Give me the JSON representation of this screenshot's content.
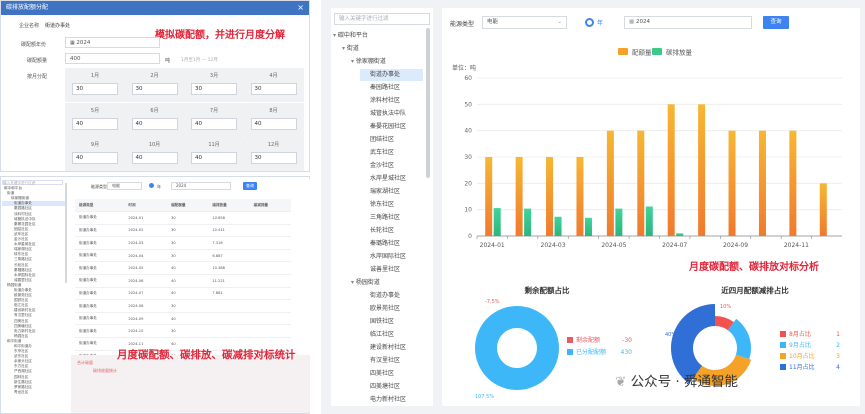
{
  "dialog": {
    "title": "碳排放配额分配",
    "close": "×",
    "enterprise_label": "企业名称",
    "enterprise_value": "街道办事处",
    "year_label": "碳配额年份",
    "year_value": "2024",
    "quota_label": "碳配额量",
    "quota_value": "400",
    "unit_label": "吨",
    "allocate_label": "按月分配",
    "range_hint": "1月至1月   —   12月",
    "months": [
      {
        "label": "1月",
        "value": "30"
      },
      {
        "label": "2月",
        "value": "30"
      },
      {
        "label": "3月",
        "value": "30"
      },
      {
        "label": "4月",
        "value": "30"
      },
      {
        "label": "5月",
        "value": "40"
      },
      {
        "label": "6月",
        "value": "40"
      },
      {
        "label": "7月",
        "value": "40"
      },
      {
        "label": "8月",
        "value": "40"
      },
      {
        "label": "9月",
        "value": "40"
      },
      {
        "label": "10月",
        "value": "40"
      },
      {
        "label": "11月",
        "value": "40"
      },
      {
        "label": "12月",
        "value": "30"
      }
    ]
  },
  "captions": {
    "c1": "模拟碳配额，并进行月度分解",
    "c2": "月度碳配额、碳排放、碳减排对标统计",
    "c3": "月度碳配额、碳排放对标分析"
  },
  "mini": {
    "search_placeholder": "输入关键字进行过滤",
    "tree": [
      "碳中和平台",
      "街道",
      "徐家棚街道",
      "街道办事处",
      "秦园路社区",
      "涂料村社区",
      "城管执法中队",
      "秦晏花园社区",
      "团结社区",
      "武车社区",
      "金沙社区",
      "水岸星城社区",
      "瑞家湖社区",
      "徐东社区",
      "三角路社区",
      "长轮社区",
      "秦璐路社区",
      "水岸国际社区",
      "诚善里社区",
      "杨园街道",
      "街道办事处",
      "欧景苑社区",
      "国铁社区",
      "临江社区",
      "建设新村社区",
      "有汉里社区",
      "四美社区",
      "四美塘社区",
      "电力新村社区",
      "杨园社区",
      "和平街道",
      "和平街道办",
      "东亭社区",
      "武东社区",
      "余家头社区",
      "东方社区",
      "严西湖社区",
      "园林社区",
      "新生路社区",
      "罗家路社区",
      "青龙社区"
    ],
    "filter_label": "能源类型",
    "filter_value": "电能",
    "radio_label": "年",
    "date_value": "2024",
    "query_label": "查询",
    "columns": [
      "能源类型",
      "时间",
      "碳配额量",
      "碳排放量",
      "碳减排量"
    ],
    "rows": [
      [
        "街道办事处",
        "2024-01",
        "30",
        "10.658",
        ""
      ],
      [
        "街道办事处",
        "2024-02",
        "30",
        "10.411",
        ""
      ],
      [
        "街道办事处",
        "2024-03",
        "30",
        "7.316",
        ""
      ],
      [
        "街道办事处",
        "2024-04",
        "30",
        "6.887",
        ""
      ],
      [
        "街道办事处",
        "2024-05",
        "40",
        "10.388",
        ""
      ],
      [
        "街道办事处",
        "2024-06",
        "40",
        "11.221",
        ""
      ],
      [
        "街道办事处",
        "2024-07",
        "40",
        "7.881",
        ""
      ],
      [
        "街道办事处",
        "2024-08",
        "30",
        "",
        " "
      ],
      [
        "街道办事处",
        "2024-09",
        "40",
        "",
        ""
      ],
      [
        "街道办事处",
        "2024-10",
        "30",
        "",
        ""
      ],
      [
        "街道办事处",
        "2024-11",
        "40",
        "",
        ""
      ],
      [
        "街道办事处",
        "2024-12",
        "30",
        "",
        ""
      ]
    ],
    "footer_a": "合计碳量",
    "footer_b": "碳排放量统计"
  },
  "right": {
    "search_placeholder": "输入关键字进行过滤",
    "tree": [
      {
        "t": "碳中和平台",
        "lvl": 0,
        "arrow": "▾"
      },
      {
        "t": "街道",
        "lvl": 1,
        "arrow": "▾"
      },
      {
        "t": "徐家棚街道",
        "lvl": 2,
        "arrow": "▾"
      },
      {
        "t": "街道办事处",
        "lvl": 3,
        "sel": true
      },
      {
        "t": "秦园路社区",
        "lvl": 3
      },
      {
        "t": "涂料村社区",
        "lvl": 3
      },
      {
        "t": "城管执法中队",
        "lvl": 3
      },
      {
        "t": "秦晏花园社区",
        "lvl": 3
      },
      {
        "t": "团结社区",
        "lvl": 3
      },
      {
        "t": "武车社区",
        "lvl": 3
      },
      {
        "t": "金沙社区",
        "lvl": 3
      },
      {
        "t": "水岸星城社区",
        "lvl": 3
      },
      {
        "t": "瑞家湖社区",
        "lvl": 3
      },
      {
        "t": "徐东社区",
        "lvl": 3
      },
      {
        "t": "三角路社区",
        "lvl": 3
      },
      {
        "t": "长轮社区",
        "lvl": 3
      },
      {
        "t": "秦璐路社区",
        "lvl": 3
      },
      {
        "t": "水岸国际社区",
        "lvl": 3
      },
      {
        "t": "诚善里社区",
        "lvl": 3
      },
      {
        "t": "杨园街道",
        "lvl": 2,
        "arrow": "▾"
      },
      {
        "t": "街道办事处",
        "lvl": 3
      },
      {
        "t": "欧景苑社区",
        "lvl": 3
      },
      {
        "t": "国铁社区",
        "lvl": 3
      },
      {
        "t": "临江社区",
        "lvl": 3
      },
      {
        "t": "建设新村社区",
        "lvl": 3
      },
      {
        "t": "有汉里社区",
        "lvl": 3
      },
      {
        "t": "四美社区",
        "lvl": 3
      },
      {
        "t": "四美塘社区",
        "lvl": 3
      },
      {
        "t": "电力新村社区",
        "lvl": 3
      }
    ],
    "energy_label": "能源类型",
    "energy_value": "电能",
    "radio_label": "年",
    "date_value": "2024",
    "query_label": "查询",
    "watermark": "公众号 · 舜通智能"
  },
  "colors": {
    "quota": "#f6a228",
    "emission": "#3cc98a",
    "remain": "#e85a64",
    "allocated": "#3db7f7"
  },
  "chart_data": [
    {
      "type": "bar",
      "ylabel": "单位：吨",
      "ylim": [
        0,
        60
      ],
      "yticks": [
        0,
        10,
        20,
        30,
        40,
        50,
        60
      ],
      "xticks": [
        "2024-01",
        "2024-03",
        "2024-05",
        "2024-07",
        "2024-09",
        "2024-11"
      ],
      "categories": [
        "2024-01",
        "2024-02",
        "2024-03",
        "2024-04",
        "2024-05",
        "2024-06",
        "2024-07",
        "2024-08",
        "2024-09",
        "2024-10",
        "2024-11",
        "2024-12"
      ],
      "series": [
        {
          "name": "配额量",
          "values": [
            30,
            30,
            30,
            30,
            40,
            40,
            50,
            50,
            40,
            40,
            40,
            20
          ]
        },
        {
          "name": "碳排放量",
          "values": [
            10.6,
            10.4,
            7.3,
            6.9,
            10.4,
            11.2,
            1.0,
            0,
            0,
            0,
            0,
            0
          ]
        }
      ],
      "legend": "top"
    },
    {
      "type": "pie",
      "title": "剩余配额占比",
      "labels": [
        "剩余配额",
        "已分配配额"
      ],
      "values": [
        -30,
        430
      ],
      "annot": [
        "-7.5%",
        "107.5%"
      ]
    },
    {
      "type": "pie",
      "title": "近四月配额减排占比",
      "labels": [
        "8月占比",
        "9月占比",
        "10月占比",
        "11月占比"
      ],
      "values": [
        1,
        2,
        3,
        4
      ],
      "annot": [
        "10%",
        "40%"
      ]
    }
  ]
}
